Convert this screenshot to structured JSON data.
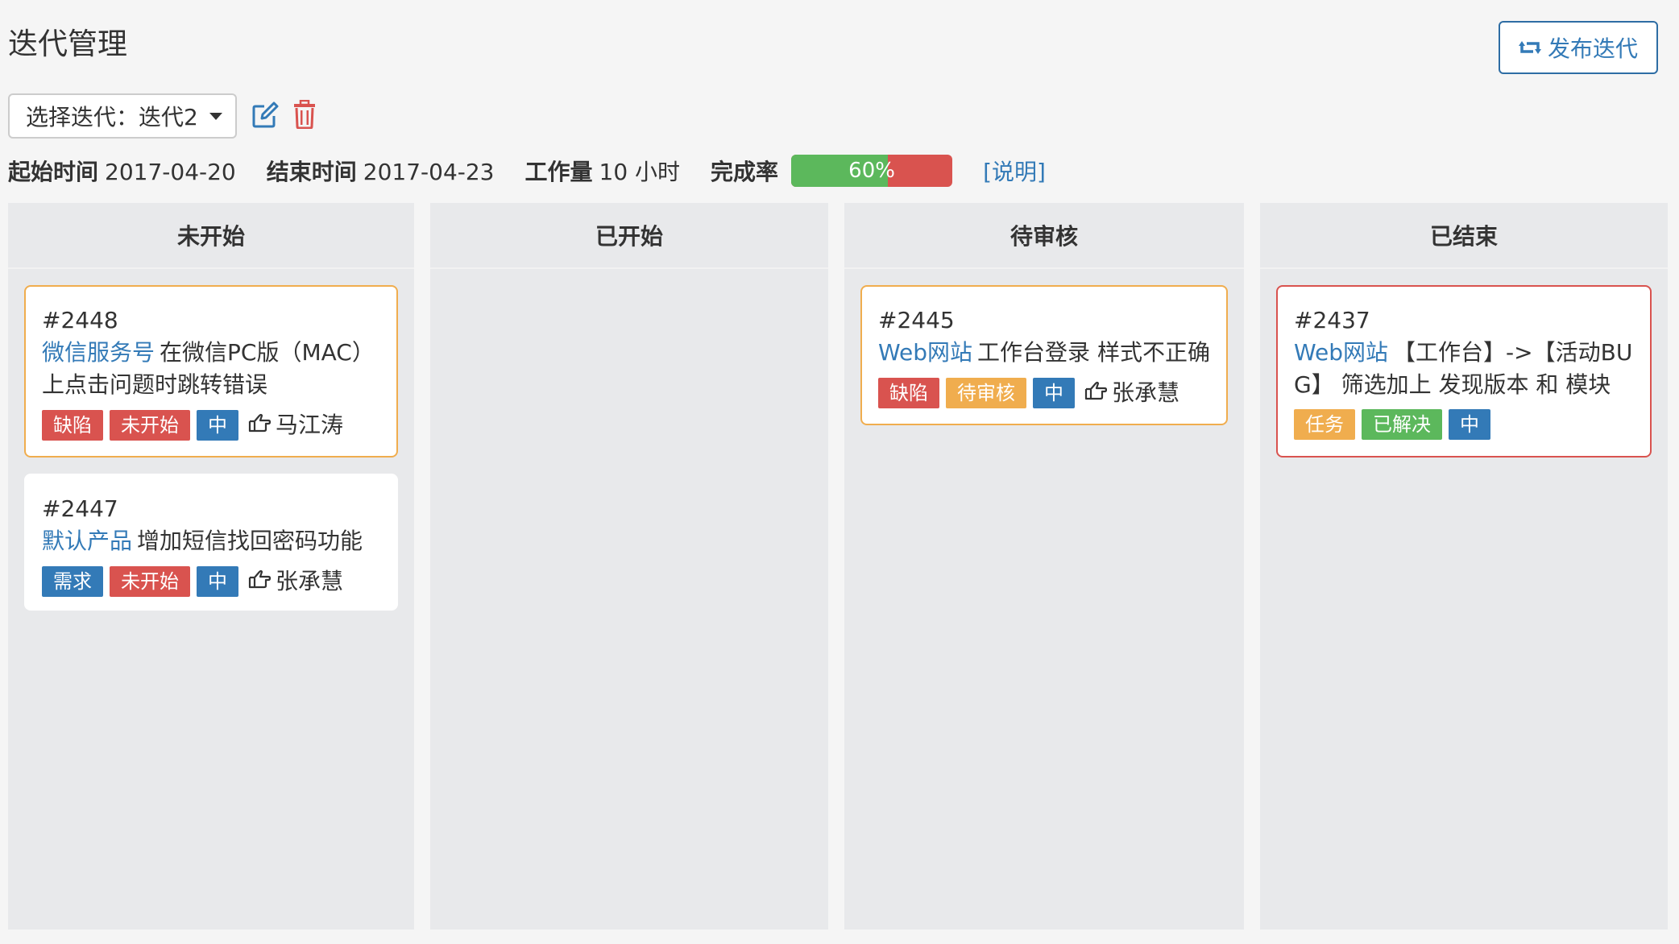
{
  "header": {
    "title": "迭代管理",
    "publish_label": "发布迭代"
  },
  "toolbar": {
    "select_label": "选择迭代：迭代2"
  },
  "info": {
    "start_label": "起始时间",
    "start_value": "2017-04-20",
    "end_label": "结束时间",
    "end_value": "2017-04-23",
    "workload_label": "工作量",
    "workload_value": "10 小时",
    "completion_label": "完成率",
    "completion_text": "60%",
    "completion_fraction": 0.6,
    "explain_link": "[说明]"
  },
  "columns": [
    {
      "title": "未开始"
    },
    {
      "title": "已开始"
    },
    {
      "title": "待审核"
    },
    {
      "title": "已结束"
    }
  ],
  "cards": {
    "c2448": {
      "id": "#2448",
      "product": "微信服务号",
      "title_line1": "在微信PC版（MAC）",
      "title_line2": "上点击问题时跳转错误",
      "tags": [
        "缺陷",
        "未开始",
        "中"
      ],
      "assignee": "马江涛"
    },
    "c2447": {
      "id": "#2447",
      "product": "默认产品",
      "title_line1": "增加短信找回密码功能",
      "tags": [
        "需求",
        "未开始",
        "中"
      ],
      "assignee": "张承慧"
    },
    "c2445": {
      "id": "#2445",
      "product": "Web网站",
      "title_line1": "工作台登录 样式不正确",
      "tags": [
        "缺陷",
        "待审核",
        "中"
      ],
      "assignee": "张承慧"
    },
    "c2437": {
      "id": "#2437",
      "product": "Web网站",
      "title_line1": "【工作台】->【活动BU",
      "title_line2": "G】 筛选加上 发现版本 和 模块",
      "tags": [
        "任务",
        "已解决",
        "中"
      ]
    }
  },
  "colors": {
    "primary": "#337ab7",
    "danger": "#d9534f",
    "warning": "#f0ad4e",
    "success": "#5cb85c"
  },
  "icons": [
    "retweet-icon",
    "edit-icon",
    "trash-icon",
    "hand-point-icon"
  ]
}
